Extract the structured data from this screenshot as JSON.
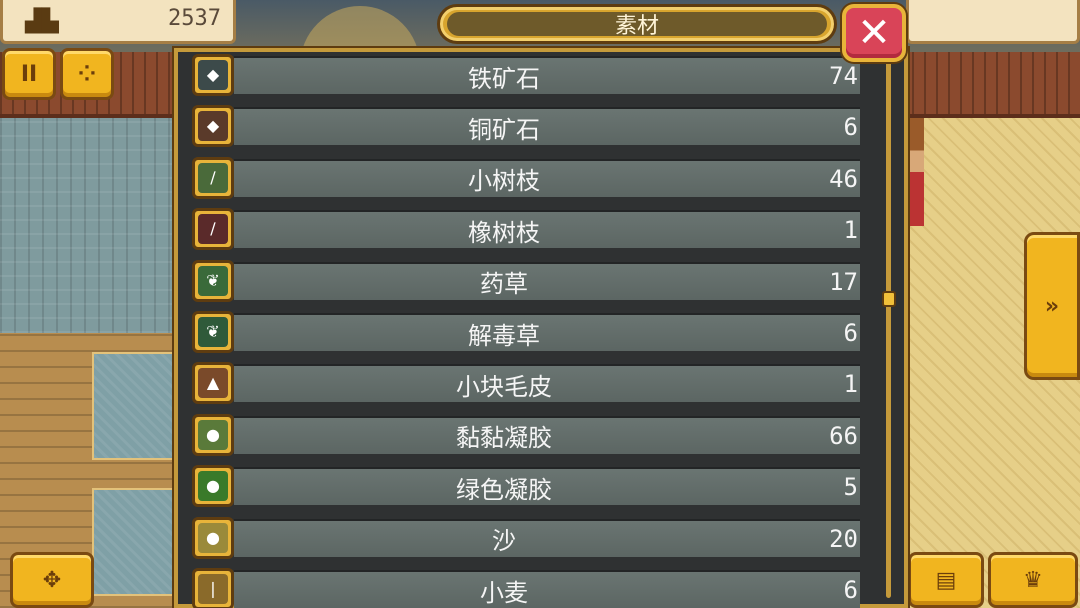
{
  "hud": {
    "gold_value": "2537",
    "gold_icon": "castle-resource-icon"
  },
  "dialog": {
    "title": "素材",
    "close_label": "✕"
  },
  "buttons": {
    "pause_label": "II",
    "inventory_icon": "coins-icon",
    "next_label": "»",
    "dpad_icon": "dpad-icon",
    "book_icon": "book-icon",
    "castle_icon": "crown-icon"
  },
  "scroll": {
    "position": 0.45
  },
  "items": [
    {
      "name": "铁矿石",
      "count": "74",
      "icon": "iron-ore-icon",
      "icon_color": "#3c4a4a",
      "glyph": "◆"
    },
    {
      "name": "铜矿石",
      "count": "6",
      "icon": "copper-ore-icon",
      "icon_color": "#5a3a2a",
      "glyph": "◆"
    },
    {
      "name": "小树枝",
      "count": "46",
      "icon": "twig-icon",
      "icon_color": "#4a6a3a",
      "glyph": "∕"
    },
    {
      "name": "橡树枝",
      "count": "1",
      "icon": "oak-branch-icon",
      "icon_color": "#5a2a2a",
      "glyph": "∕"
    },
    {
      "name": "药草",
      "count": "17",
      "icon": "herb-icon",
      "icon_color": "#3a6a3a",
      "glyph": "❦"
    },
    {
      "name": "解毒草",
      "count": "6",
      "icon": "antidote-herb-icon",
      "icon_color": "#2f5a3a",
      "glyph": "❦"
    },
    {
      "name": "小块毛皮",
      "count": "1",
      "icon": "fur-icon",
      "icon_color": "#7a4a2a",
      "glyph": "▲"
    },
    {
      "name": "黏黏凝胶",
      "count": "66",
      "icon": "sticky-gel-icon",
      "icon_color": "#5a7a3a",
      "glyph": "●"
    },
    {
      "name": "绿色凝胶",
      "count": "5",
      "icon": "green-gel-icon",
      "icon_color": "#3a7a2a",
      "glyph": "●"
    },
    {
      "name": "沙",
      "count": "20",
      "icon": "sand-icon",
      "icon_color": "#9a8a3a",
      "glyph": "●"
    },
    {
      "name": "小麦",
      "count": "6",
      "icon": "wheat-icon",
      "icon_color": "#8a6a2a",
      "glyph": "❘"
    }
  ]
}
